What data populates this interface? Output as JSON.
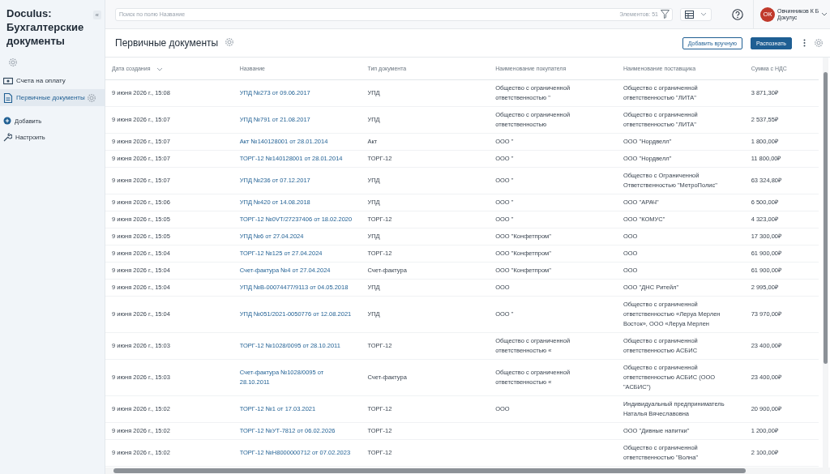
{
  "app": {
    "title": "Doculus: Бухгалтерские документы",
    "collapse": "«"
  },
  "sidebar": {
    "items": [
      {
        "label": "Счета на оплату",
        "selected": false
      },
      {
        "label": "Первичные документы",
        "selected": true
      }
    ],
    "actions": [
      {
        "label": "Добавить"
      },
      {
        "label": "Настроить"
      }
    ]
  },
  "topbar": {
    "search": {
      "placeholder": "Поиск по полю Название"
    },
    "count": "Элементов: 51",
    "user": {
      "initials": "ОК",
      "name": "Овчинников К Б",
      "org": "Докулус"
    }
  },
  "header": {
    "title": "Первичные документы",
    "buttons": [
      {
        "label": "Добавить вручную",
        "kind": "secondary"
      },
      {
        "label": "Распознать",
        "kind": "primary"
      }
    ]
  },
  "table": {
    "columns": [
      {
        "label": "Дата создания",
        "sorted": true
      },
      {
        "label": "Название",
        "sorted": false
      },
      {
        "label": "Тип документа",
        "sorted": false
      },
      {
        "label": "Наименование покупателя",
        "sorted": false
      },
      {
        "label": "Наименование поставщика",
        "sorted": false
      },
      {
        "label": "Сумма с НДС",
        "sorted": false
      }
    ],
    "rows": [
      [
        "9 июня 2026 г., 15:08",
        "УПД №273 от 09.06.2017",
        "УПД",
        "Общество с ограниченной ответственностью \"",
        "Общество с ограниченной ответственностью \"ЛИТА\"",
        "3 871,30₽"
      ],
      [
        "9 июня 2026 г., 15:07",
        "УПД №791 от 21.08.2017",
        "УПД",
        "Общество с ограниченной ответственностью",
        "Общество с ограниченной ответственностью \"ЛИТА\"",
        "2 537,55₽"
      ],
      [
        "9 июня 2026 г., 15:07",
        "Акт №140128001 от 28.01.2014",
        "Акт",
        "ООО \"",
        "ООО \"Нордвелл\"",
        "1 800,00₽"
      ],
      [
        "9 июня 2026 г., 15:07",
        "ТОРГ-12 №140128001 от 28.01.2014",
        "ТОРГ-12",
        "ООО \"",
        "ООО \"Нордвелл\"",
        "11 800,00₽"
      ],
      [
        "9 июня 2026 г., 15:07",
        "УПД №236 от 07.12.2017",
        "УПД",
        "ООО \"",
        "Общество с Ограниченной Ответственностью \"МетроПолис\"",
        "63 324,80₽"
      ],
      [
        "9 июня 2026 г., 15:06",
        "УПД №420 от 14.08.2018",
        "УПД",
        "ООО \"",
        "ООО \"АРАЧ\"",
        "6 500,00₽"
      ],
      [
        "9 июня 2026 г., 15:05",
        "ТОРГ-12 №0VT/27237406 от 18.02.2020",
        "ТОРГ-12",
        "ООО \"",
        "ООО \"КОМУС\"",
        "4 323,00₽"
      ],
      [
        "9 июня 2026 г., 15:05",
        "УПД №6 от 27.04.2024",
        "УПД",
        "ООО \"Конфетпром\"",
        "ООО",
        "17 300,00₽"
      ],
      [
        "9 июня 2026 г., 15:04",
        "ТОРГ-12 №125 от 27.04.2024",
        "ТОРГ-12",
        "ООО \"Конфетпром\"",
        "ООО",
        "61 900,00₽"
      ],
      [
        "9 июня 2026 г., 15:04",
        "Счет-фактура №4 от 27.04.2024",
        "Счет-фактура",
        "ООО \"Конфетпром\"",
        "ООО",
        "61 900,00₽"
      ],
      [
        "9 июня 2026 г., 15:04",
        "УПД №В-00074477/9113 от 04.05.2018",
        "УПД",
        "ООО",
        "ООО \"ДНС Ритейл\"",
        "2 995,00₽"
      ],
      [
        "9 июня 2026 г., 15:04",
        "УПД №051/2021-0050776 от 12.08.2021",
        "УПД",
        "ООО \"",
        "Общество с ограниченной ответственностью «Леруа Мерлен Восток», ООО «Леруа Мерлен",
        "73 970,00₽"
      ],
      [
        "9 июня 2026 г., 15:03",
        "ТОРГ-12 №1028/0095 от 28.10.2011",
        "ТОРГ-12",
        "Общество с ограниченной ответственностью «",
        "Общество с ограниченной ответственностью АСБИС",
        "23 400,00₽"
      ],
      [
        "9 июня 2026 г., 15:03",
        "Счет-фактура №1028/0095 от 28.10.2011",
        "Счет-фактура",
        "Общество с ограниченной ответственностью «",
        "Общество с ограниченной ответственностью АСБИС (ООО \"АСБИС\")",
        "23 400,00₽"
      ],
      [
        "9 июня 2026 г., 15:02",
        "ТОРГ-12 №1 от 17.03.2021",
        "ТОРГ-12",
        "ООО",
        "Индивидуальный предприниматель Наталья Вячеславовна",
        "20 900,00₽"
      ],
      [
        "9 июня 2026 г., 15:02",
        "ТОРГ-12 №УТ-7812 от 06.02.2026",
        "ТОРГ-12",
        "",
        "ООО \"Дивные напитки\"",
        "1 200,00₽"
      ],
      [
        "9 июня 2026 г., 15:02",
        "ТОРГ-12 №Н8000000712 от 07.02.2023",
        "ТОРГ-12",
        "",
        "Общество с ограниченной ответственностью \"Волна\"",
        "2 100,00₽"
      ]
    ]
  }
}
